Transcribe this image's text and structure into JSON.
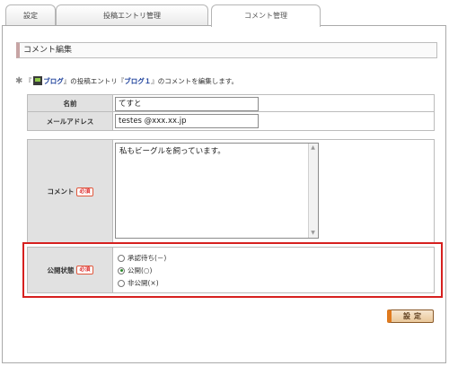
{
  "tabs": [
    {
      "label": "設定",
      "active": false
    },
    {
      "label": "投稿エントリ管理",
      "active": false
    },
    {
      "label": "コメント管理",
      "active": true
    }
  ],
  "heading": "コメント編集",
  "note": {
    "star": "✱",
    "open": "『",
    "blog_link": "ブログ",
    "mid": "』の投稿エントリ『",
    "entry_link": "ブログ１",
    "tail": "』のコメントを編集します。"
  },
  "form": {
    "name": {
      "label": "名前",
      "value": "てすと"
    },
    "email": {
      "label": "メールアドレス",
      "value": "testes @xxx.xx.jp"
    },
    "comment": {
      "label": "コメント",
      "required": "必須",
      "value": "私もビーグルを飼っています。"
    },
    "status": {
      "label": "公開状態",
      "required": "必須",
      "options": [
        {
          "label": "承認待ち(－)",
          "checked": false
        },
        {
          "label": "公開(○)",
          "checked": true
        },
        {
          "label": "非公開(×)",
          "checked": false
        }
      ]
    }
  },
  "submit_label": "設定",
  "colors": {
    "highlight": "#d6201f",
    "accent": "#e07a1e",
    "link": "#1a3e9a"
  }
}
